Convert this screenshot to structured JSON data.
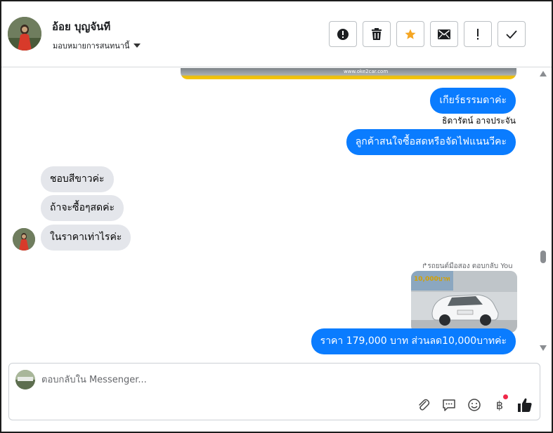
{
  "header": {
    "contact_name": "อ้อย บุญจันที",
    "assign_label": "มอบหมายการสนทนานี้",
    "actions": [
      "spam",
      "delete",
      "star",
      "email",
      "follow-up",
      "done"
    ]
  },
  "chat": {
    "top_image_caption": "www.oke2car.com",
    "messages_out_1": "เกียร์ธรรมดาค่ะ",
    "sender_name": "ธิดารัตน์ อาจประจัน",
    "messages_out_2": "ลูกค้าสนใจซื้อสดหรือจัดไฟแนนวีคะ",
    "messages_in": [
      "ชอบสีขาวค่ะ",
      "ถ้าจะซื้อๆสดค่ะ",
      "ในราคาเท่าไรค่ะ"
    ],
    "reply_label": "↱รถยนต์มือสอง ตอบกลับ You",
    "car_card_promo": "10,000บาท",
    "messages_out_3": "ราคา 179,000 บาท ส่วนลด10,000บาทค่ะ"
  },
  "composer": {
    "placeholder": "ตอบกลับใน Messenger...",
    "tools": [
      "attach-icon",
      "saved-replies-icon",
      "emoji-icon",
      "baht-icon",
      "like-icon"
    ],
    "baht_symbol": "฿"
  },
  "colors": {
    "outgoing_bubble": "#0a7cff",
    "incoming_bubble": "#e4e6eb",
    "star": "#f5a623",
    "notification_dot": "#f02849"
  }
}
